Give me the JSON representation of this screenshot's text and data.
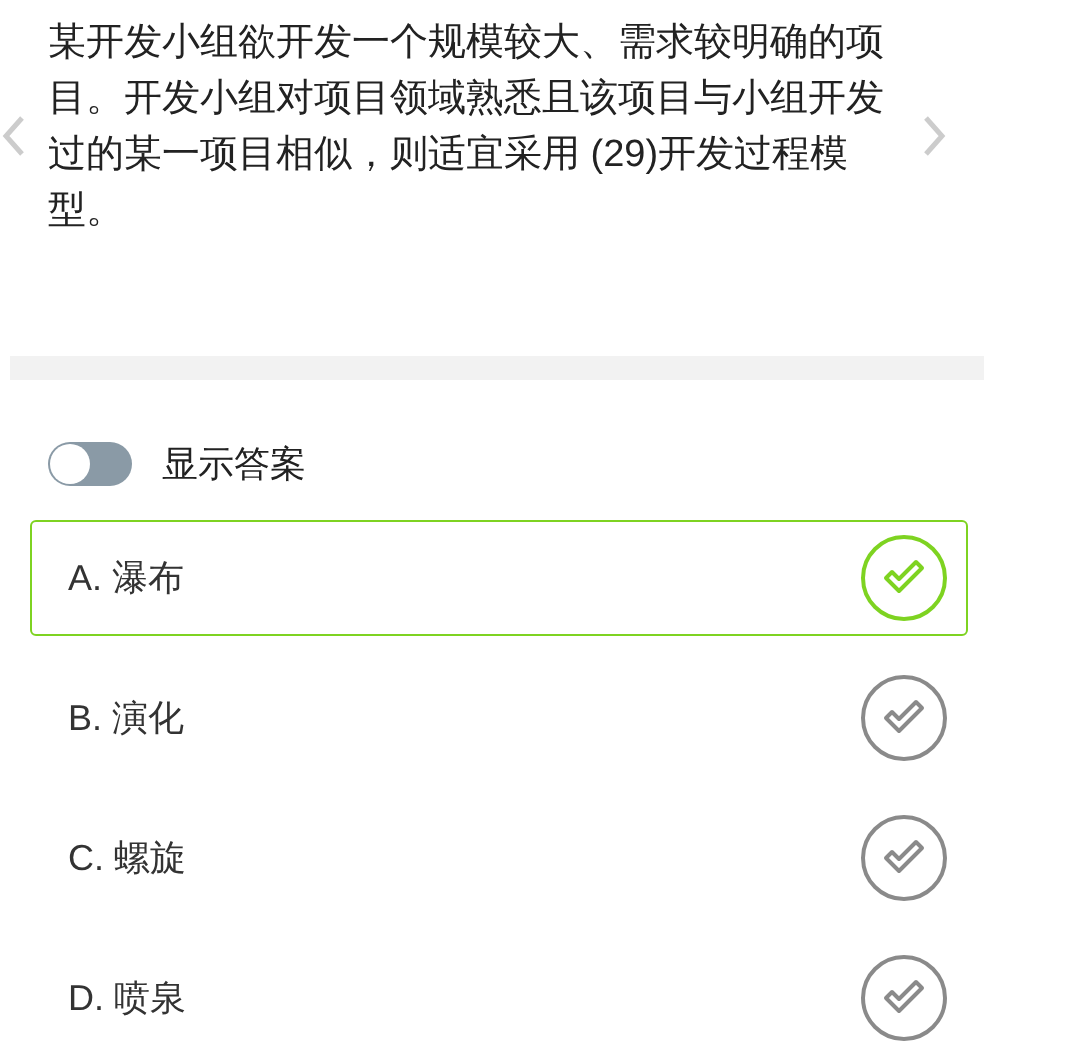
{
  "question": "某开发小组欲开发一个规模较大、需求较明确的项目。开发小组对项目领域熟悉且该项目与小组开发过的某一项目相似，则适宜采用 (29)开发过程模型。",
  "show_answer": {
    "label": "显示答案",
    "on": false
  },
  "options": [
    {
      "label": "A. 瀑布",
      "selected": true
    },
    {
      "label": "B. 演化",
      "selected": false
    },
    {
      "label": "C. 螺旋",
      "selected": false
    },
    {
      "label": "D. 喷泉",
      "selected": false
    }
  ]
}
